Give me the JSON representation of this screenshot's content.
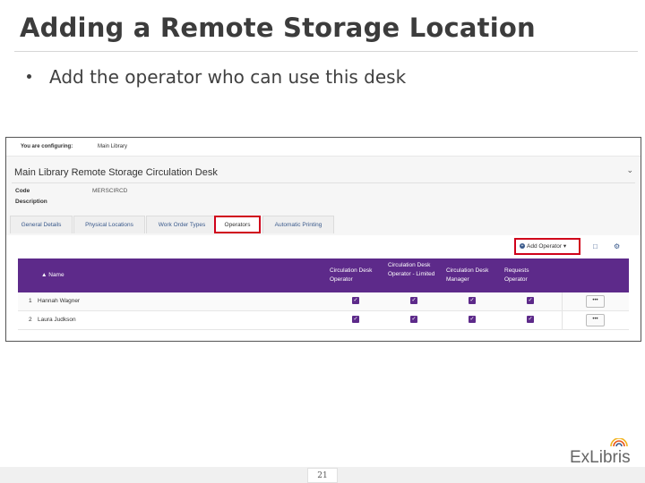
{
  "slide": {
    "title": "Adding a Remote Storage Location",
    "bullet": "Add the operator who can use this desk",
    "page_number": "21"
  },
  "screenshot": {
    "configuring_label": "You are configuring:",
    "configuring_value": "Main Library",
    "desk_title": "Main Library Remote Storage Circulation Desk",
    "fields": [
      {
        "label": "Code",
        "value": "MERSCIRCD"
      },
      {
        "label": "Description",
        "value": ""
      }
    ],
    "tabs": [
      "General Details",
      "Physical Locations",
      "Work Order Types",
      "Operators",
      "Automatic Printing"
    ],
    "active_tab": "Operators",
    "add_operator_label": "Add Operator",
    "columns": {
      "name": "Name",
      "circ_operator": "Circulation Desk Operator",
      "circ_limited": "Circulation Desk Operator - Limited",
      "circ_manager": "Circulation Desk Manager",
      "requests_operator": "Requests Operator"
    },
    "rows": [
      {
        "index": "1",
        "name": "Hannah Wagner",
        "checks": [
          true,
          true,
          true,
          true
        ]
      },
      {
        "index": "2",
        "name": "Laura Judkson",
        "checks": [
          true,
          true,
          true,
          true
        ]
      }
    ],
    "row_menu_label": "•••"
  },
  "logo": {
    "text": "ExLibris"
  },
  "colors": {
    "accent": "#5d2a8a",
    "highlight": "#d0021b",
    "link": "#3a5a8c"
  }
}
